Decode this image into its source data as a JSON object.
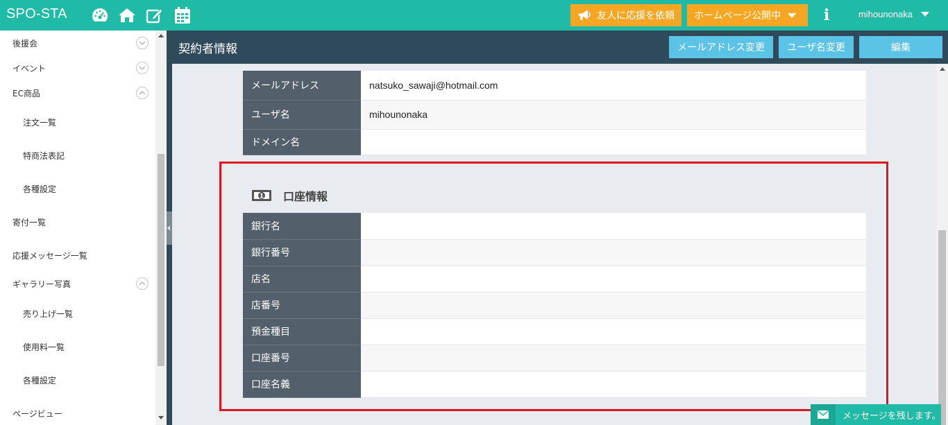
{
  "header": {
    "brand": "SPO-STA",
    "icons": [
      "dashboard-icon",
      "home-icon",
      "edit-icon",
      "calendar-icon"
    ],
    "invite_button": "友人に応援を依頼",
    "homepage_button": "ホームページ公開中",
    "info_icon": "info-icon",
    "user": "mihounonaka",
    "accent_color": "#1fbba6",
    "orange_color": "#f5a623"
  },
  "sidebar": {
    "items": [
      {
        "label": "後援会",
        "level": 1,
        "expand": "down"
      },
      {
        "label": "イベント",
        "level": 1,
        "expand": "down"
      },
      {
        "label": "EC商品",
        "level": 1,
        "expand": "up"
      },
      {
        "label": "注文一覧",
        "level": 2
      },
      {
        "label": "特商法表記",
        "level": 2
      },
      {
        "label": "各種設定",
        "level": 2
      },
      {
        "label": "寄付一覧",
        "level": 1
      },
      {
        "label": "応援メッセージ一覧",
        "level": 1
      },
      {
        "label": "ギャラリー写真",
        "level": 1,
        "expand": "up"
      },
      {
        "label": "売り上げ一覧",
        "level": 2
      },
      {
        "label": "使用料一覧",
        "level": 2
      },
      {
        "label": "各種設定",
        "level": 2
      },
      {
        "label": "ページビュー",
        "level": 1
      }
    ]
  },
  "page": {
    "title": "契約者情報",
    "buttons": {
      "change_email": "メールアドレス変更",
      "change_username": "ユーザ名変更",
      "edit": "編集"
    }
  },
  "account": {
    "rows": [
      {
        "key": "メールアドレス",
        "value": "natsuko_sawaji@hotmail.com"
      },
      {
        "key": "ユーザ名",
        "value": "mihounonaka"
      },
      {
        "key": "ドメイン名",
        "value": ""
      }
    ]
  },
  "bank": {
    "title": "口座情報",
    "icon": "banknote-icon",
    "rows": [
      {
        "key": "銀行名",
        "value": ""
      },
      {
        "key": "銀行番号",
        "value": ""
      },
      {
        "key": "店名",
        "value": ""
      },
      {
        "key": "店番号",
        "value": ""
      },
      {
        "key": "預金種目",
        "value": ""
      },
      {
        "key": "口座番号",
        "value": ""
      },
      {
        "key": "口座名義",
        "value": ""
      }
    ]
  },
  "message_button": "メッセージを残します。"
}
